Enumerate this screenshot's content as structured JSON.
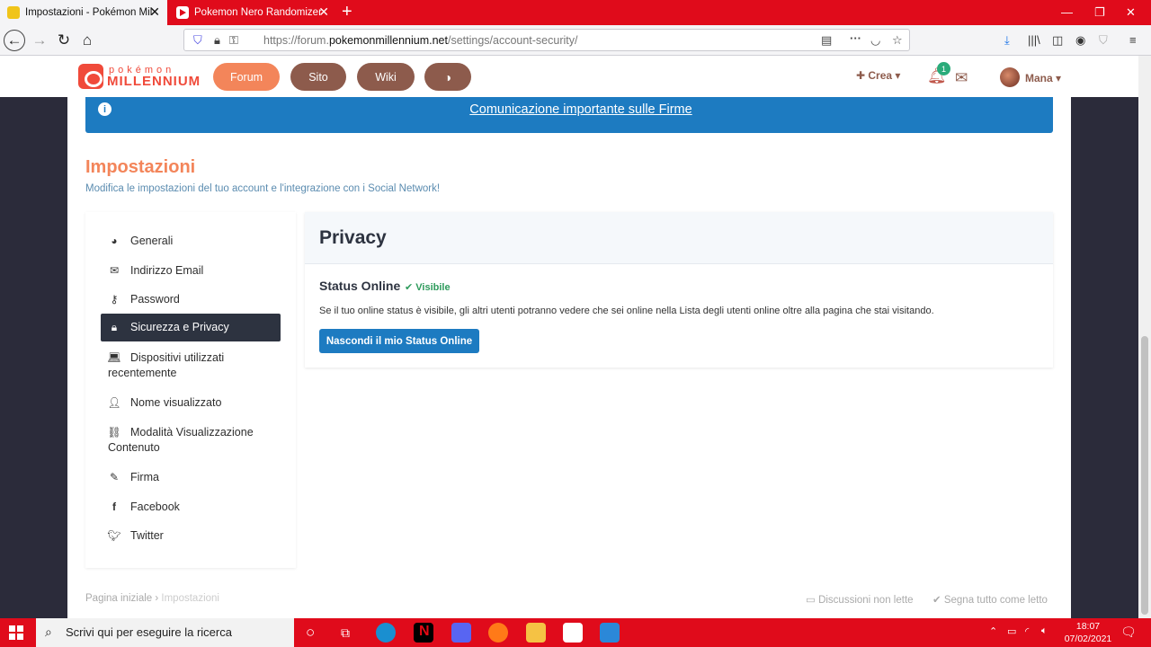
{
  "browser": {
    "tabs": [
      {
        "title": "Impostazioni - Pokémon Millenn",
        "active": true
      },
      {
        "title": "Pokemon Nero Randomizer Nu",
        "active": false
      }
    ],
    "new_tab": "+",
    "window_controls": {
      "minimize": "—",
      "restore": "❐",
      "close": "✕"
    },
    "url": {
      "prefix": "https://forum.",
      "host": "pokemonmillennium.net",
      "path": "/settings/account-security/"
    }
  },
  "site": {
    "logo_top": "pokémon",
    "logo_bottom": "MILLENNIUM",
    "nav": {
      "forum": "Forum",
      "sito": "Sito",
      "wiki": "Wiki",
      "theme_icon": "contrast-icon"
    },
    "create": "Crea",
    "notifications_count": "1",
    "user": "Mana"
  },
  "notice": {
    "text": "Comunicazione importante sulle Firme"
  },
  "page": {
    "title": "Impostazioni",
    "subtitle": "Modifica le impostazioni del tuo account e l'integrazione con i Social Network!"
  },
  "sidebar": {
    "items": [
      {
        "label": "Generali",
        "icon": "dashboard-icon"
      },
      {
        "label": "Indirizzo Email",
        "icon": "envelope-icon"
      },
      {
        "label": "Password",
        "icon": "key-icon"
      },
      {
        "label": "Sicurezza e Privacy",
        "icon": "lock-icon",
        "active": true
      },
      {
        "label_line1": "Dispositivi utilizzati",
        "label_line2": "recentemente",
        "icon": "laptop-icon"
      },
      {
        "label": "Nome visualizzato",
        "icon": "user-icon"
      },
      {
        "label_line1": "Modalità Visualizzazione",
        "label_line2": "Contenuto",
        "icon": "link-icon"
      },
      {
        "label": "Firma",
        "icon": "pencil-icon"
      },
      {
        "label": "Facebook",
        "icon": "facebook-icon"
      },
      {
        "label": "Twitter",
        "icon": "twitter-icon"
      }
    ]
  },
  "privacy": {
    "title": "Privacy",
    "status_label": "Status Online",
    "status_value": "Visibile",
    "description": "Se il tuo online status è visibile, gli altri utenti potranno vedere che sei online nella Lista degli utenti online oltre alla pagina che stai visitando.",
    "button": "Nascondi il mio Status Online"
  },
  "footer": {
    "breadcrumb_home": "Pagina iniziale",
    "breadcrumb_current": "Impostazioni",
    "unread": "Discussioni non lette",
    "mark_read": "Segna tutto come letto"
  },
  "taskbar": {
    "search_placeholder": "Scrivi qui per eseguire la ricerca",
    "time": "18:07",
    "date": "07/02/2021"
  },
  "colors": {
    "accent": "#f3855a",
    "brown": "#8d5b4c",
    "primary_blue": "#1d7bc1",
    "active_nav": "#2d3340",
    "success": "#2e9b5c",
    "browser_red": "#e00b1b"
  }
}
